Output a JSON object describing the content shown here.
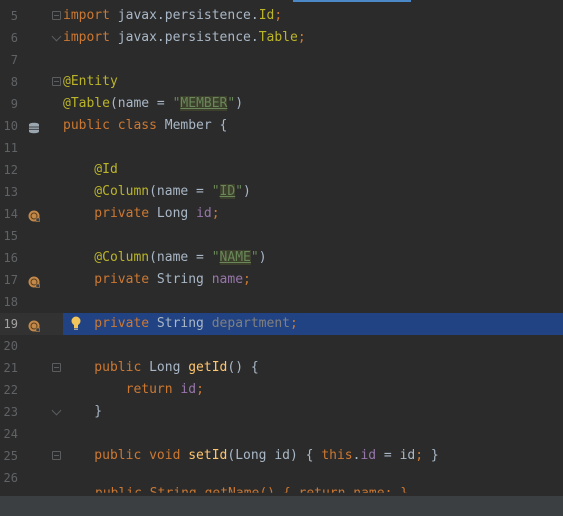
{
  "editor": {
    "lines": [
      {
        "number": "5",
        "segments": [
          {
            "t": "import ",
            "c": "kw"
          },
          {
            "t": "javax.persistence.",
            "c": "plain"
          },
          {
            "t": "Id",
            "c": "ann"
          },
          {
            "t": ";",
            "c": "kw"
          }
        ]
      },
      {
        "number": "6",
        "segments": [
          {
            "t": "import ",
            "c": "kw"
          },
          {
            "t": "javax.persistence.",
            "c": "plain"
          },
          {
            "t": "Table",
            "c": "ann"
          },
          {
            "t": ";",
            "c": "kw"
          }
        ]
      },
      {
        "number": "7",
        "segments": []
      },
      {
        "number": "8",
        "segments": [
          {
            "t": "@Entity",
            "c": "ann"
          }
        ]
      },
      {
        "number": "9",
        "segments": [
          {
            "t": "@Table",
            "c": "ann"
          },
          {
            "t": "(name = ",
            "c": "plain"
          },
          {
            "t": "\"",
            "c": "str"
          },
          {
            "t": "MEMBER",
            "c": "strhl"
          },
          {
            "t": "\"",
            "c": "str"
          },
          {
            "t": ")",
            "c": "plain"
          }
        ]
      },
      {
        "number": "10",
        "segments": [
          {
            "t": "public class ",
            "c": "kw"
          },
          {
            "t": "Member {",
            "c": "plain"
          }
        ]
      },
      {
        "number": "11",
        "segments": []
      },
      {
        "number": "12",
        "segments": [
          {
            "t": "    @Id",
            "c": "ann"
          }
        ]
      },
      {
        "number": "13",
        "segments": [
          {
            "t": "    @Column",
            "c": "ann"
          },
          {
            "t": "(name = ",
            "c": "plain"
          },
          {
            "t": "\"",
            "c": "str"
          },
          {
            "t": "ID",
            "c": "strhl"
          },
          {
            "t": "\"",
            "c": "str"
          },
          {
            "t": ")",
            "c": "plain"
          }
        ]
      },
      {
        "number": "14",
        "segments": [
          {
            "t": "    private ",
            "c": "kw"
          },
          {
            "t": "Long ",
            "c": "plain"
          },
          {
            "t": "id",
            "c": "field"
          },
          {
            "t": ";",
            "c": "kw"
          }
        ]
      },
      {
        "number": "15",
        "segments": []
      },
      {
        "number": "16",
        "segments": [
          {
            "t": "    @Column",
            "c": "ann"
          },
          {
            "t": "(name = ",
            "c": "plain"
          },
          {
            "t": "\"",
            "c": "str"
          },
          {
            "t": "NAME",
            "c": "strhl"
          },
          {
            "t": "\"",
            "c": "str"
          },
          {
            "t": ")",
            "c": "plain"
          }
        ]
      },
      {
        "number": "17",
        "segments": [
          {
            "t": "    private ",
            "c": "kw"
          },
          {
            "t": "String ",
            "c": "plain"
          },
          {
            "t": "name",
            "c": "field"
          },
          {
            "t": ";",
            "c": "kw"
          }
        ]
      },
      {
        "number": "18",
        "segments": []
      },
      {
        "number": "19",
        "segments": [
          {
            "t": "    private ",
            "c": "kw"
          },
          {
            "t": "String ",
            "c": "plain"
          },
          {
            "t": "department",
            "c": "dim"
          },
          {
            "t": ";",
            "c": "kw"
          }
        ]
      },
      {
        "number": "20",
        "segments": []
      },
      {
        "number": "21",
        "segments": [
          {
            "t": "    public ",
            "c": "kw"
          },
          {
            "t": "Long ",
            "c": "plain"
          },
          {
            "t": "getId",
            "c": "method"
          },
          {
            "t": "() {",
            "c": "plain"
          }
        ]
      },
      {
        "number": "22",
        "segments": [
          {
            "t": "        return ",
            "c": "kw"
          },
          {
            "t": "id",
            "c": "field"
          },
          {
            "t": ";",
            "c": "kw"
          }
        ]
      },
      {
        "number": "23",
        "segments": [
          {
            "t": "    }",
            "c": "plain"
          }
        ]
      },
      {
        "number": "24",
        "segments": []
      },
      {
        "number": "25",
        "segments": [
          {
            "t": "    public void ",
            "c": "kw"
          },
          {
            "t": "setId",
            "c": "method"
          },
          {
            "t": "(Long id) ",
            "c": "plain"
          },
          {
            "t": "{ ",
            "c": "plain"
          },
          {
            "t": "this",
            "c": "kw"
          },
          {
            "t": ".",
            "c": "plain"
          },
          {
            "t": "id",
            "c": "field"
          },
          {
            "t": " = id",
            "c": "plain"
          },
          {
            "t": ";",
            "c": "kw"
          },
          {
            "t": " }",
            "c": "plain"
          }
        ]
      },
      {
        "number": "26",
        "segments": []
      }
    ],
    "current_line": "19",
    "partial_last_line": "public String getName() { return name; }",
    "colors": {
      "background": "#2b2b2b",
      "current_line_highlight": "#214283",
      "keyword": "#cc7832",
      "annotation": "#bbb529",
      "string": "#6a8759",
      "field": "#9876aa",
      "method": "#ffc66d"
    },
    "gutter_icons": {
      "10": "database-table-icon",
      "14": "entity-attribute-icon",
      "17": "entity-attribute-icon",
      "19": "entity-attribute-icon"
    },
    "intention_icon": "lightbulb-icon"
  }
}
